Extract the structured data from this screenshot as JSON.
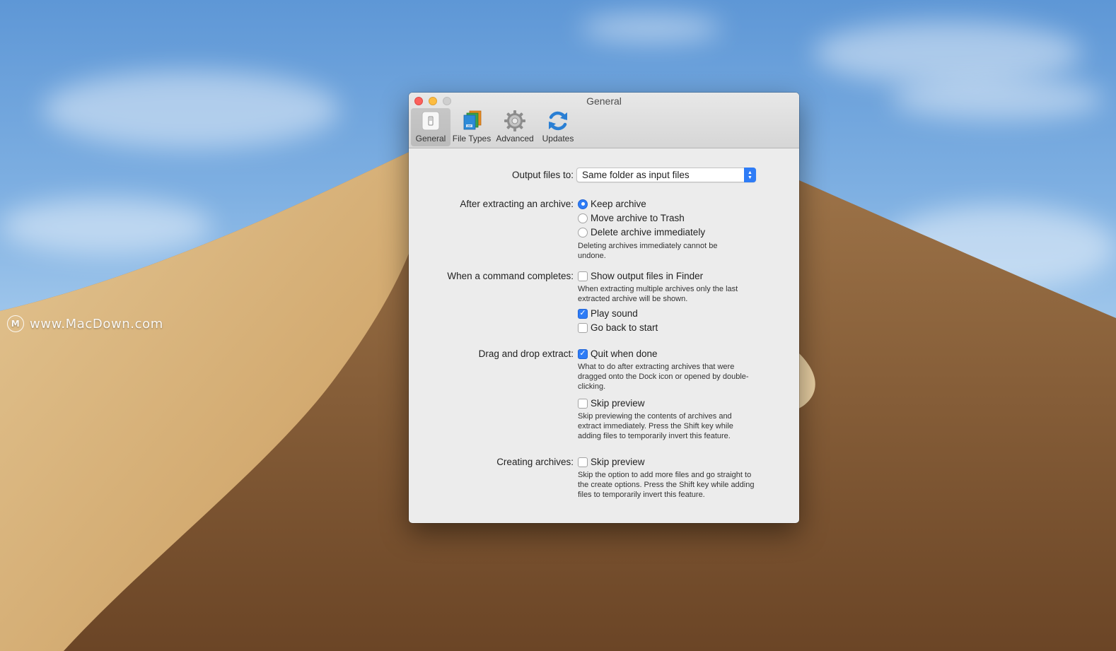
{
  "window": {
    "title": "General"
  },
  "watermark": {
    "text": "www.MacDown.com",
    "logo": "M"
  },
  "toolbar": {
    "items": [
      {
        "label": "General",
        "icon": "switch-icon",
        "selected": true
      },
      {
        "label": "File Types",
        "icon": "file-stack-icon",
        "selected": false
      },
      {
        "label": "Advanced",
        "icon": "gear-icon",
        "selected": false
      },
      {
        "label": "Updates",
        "icon": "refresh-icon",
        "selected": false
      }
    ]
  },
  "output": {
    "label": "Output files to:",
    "value": "Same folder as input files"
  },
  "after_extract": {
    "label": "After extracting an archive:",
    "options": [
      "Keep archive",
      "Move archive to Trash",
      "Delete archive immediately"
    ],
    "selected": "Keep archive",
    "help": "Deleting archives immediately cannot be undone."
  },
  "command_completes": {
    "label": "When a command completes:",
    "show_finder": {
      "label": "Show output files in Finder",
      "checked": false
    },
    "show_finder_help": "When extracting multiple archives only the last extracted archive will be shown.",
    "play_sound": {
      "label": "Play sound",
      "checked": true
    },
    "go_back": {
      "label": "Go back to start",
      "checked": false
    }
  },
  "drag_drop": {
    "label": "Drag and drop extract:",
    "quit": {
      "label": "Quit when done",
      "checked": true
    },
    "quit_help": "What to do after extracting archives that were dragged onto the Dock icon or opened by double-clicking.",
    "skip_preview": {
      "label": "Skip preview",
      "checked": false
    },
    "skip_help": "Skip previewing the contents of archives and extract immediately. Press the Shift key while adding files to temporarily invert this feature."
  },
  "creating": {
    "label": "Creating archives:",
    "skip_preview": {
      "label": "Skip preview",
      "checked": false
    },
    "skip_help": "Skip the option to add more files and go straight to the create options. Press the Shift key while adding files to temporarily invert this feature."
  },
  "colors": {
    "accent": "#2e7cf6",
    "close": "#fc605c",
    "minimize": "#fdbc40"
  }
}
